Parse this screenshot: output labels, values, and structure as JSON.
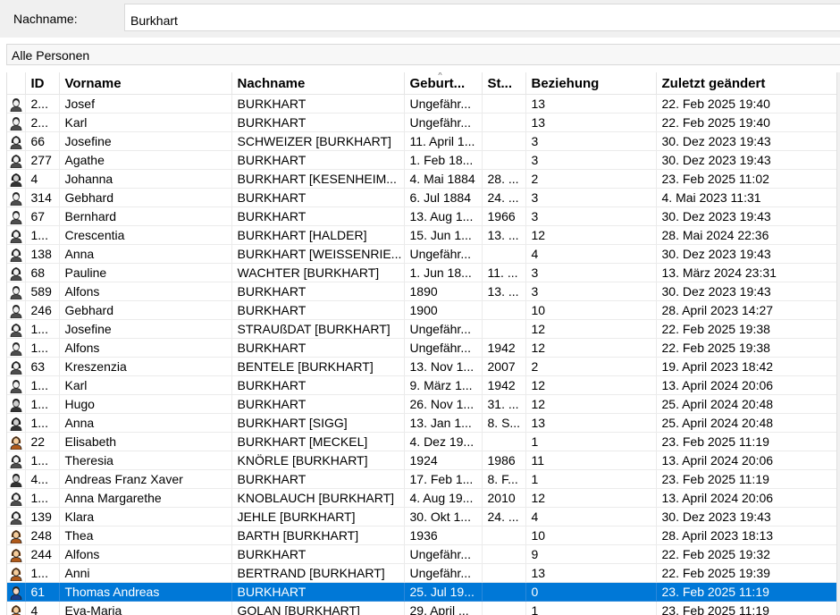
{
  "search": {
    "label": "Nachname:",
    "value": "Burkhart"
  },
  "filter": {
    "label": "Alle Personen"
  },
  "columns": [
    "ID",
    "Vorname",
    "Nachname",
    "Geburt...",
    "St...",
    "Beziehung",
    "Zuletzt geändert"
  ],
  "rows": [
    {
      "icon": "male",
      "id": "2...",
      "first": "Josef",
      "last": "BURKHART",
      "birth": "Ungefähr...",
      "death": "",
      "rel": "13",
      "changed": "22. Feb 2025 19:40"
    },
    {
      "icon": "male",
      "id": "2...",
      "first": "Karl",
      "last": "BURKHART",
      "birth": "Ungefähr...",
      "death": "",
      "rel": "13",
      "changed": "22. Feb 2025 19:40"
    },
    {
      "icon": "female",
      "id": "66",
      "first": "Josefine",
      "last": "SCHWEIZER [BURKHART]",
      "birth": "11. April 1...",
      "death": "",
      "rel": "3",
      "changed": "30. Dez 2023 19:43"
    },
    {
      "icon": "female",
      "id": "277",
      "first": "Agathe",
      "last": "BURKHART",
      "birth": "1. Feb 18...",
      "death": "",
      "rel": "3",
      "changed": "30. Dez 2023 19:43"
    },
    {
      "icon": "female-photo",
      "id": "4",
      "first": "Johanna",
      "last": "BURKHART [KESENHEIM...",
      "birth": "4. Mai 1884",
      "death": "28. ...",
      "rel": "2",
      "changed": "23. Feb 2025 11:02"
    },
    {
      "icon": "male",
      "id": "314",
      "first": "Gebhard",
      "last": "BURKHART",
      "birth": "6. Jul 1884",
      "death": "24. ...",
      "rel": "3",
      "changed": "4. Mai 2023 11:31"
    },
    {
      "icon": "male",
      "id": "67",
      "first": "Bernhard",
      "last": "BURKHART",
      "birth": "13. Aug 1...",
      "death": "1966",
      "rel": "3",
      "changed": "30. Dez 2023 19:43"
    },
    {
      "icon": "female",
      "id": "1...",
      "first": "Crescentia",
      "last": "BURKHART [HALDER]",
      "birth": "15. Jun 1...",
      "death": "13. ...",
      "rel": "12",
      "changed": "28. Mai 2024 22:36"
    },
    {
      "icon": "female",
      "id": "138",
      "first": "Anna",
      "last": "BURKHART [WEISSENRIE...",
      "birth": "Ungefähr...",
      "death": "",
      "rel": "4",
      "changed": "30. Dez 2023 19:43"
    },
    {
      "icon": "female",
      "id": "68",
      "first": "Pauline",
      "last": "WACHTER [BURKHART]",
      "birth": "1. Jun 18...",
      "death": "11. ...",
      "rel": "3",
      "changed": "13. März 2024 23:31"
    },
    {
      "icon": "male",
      "id": "589",
      "first": "Alfons",
      "last": "BURKHART",
      "birth": "1890",
      "death": "13. ...",
      "rel": "3",
      "changed": "30. Dez 2023 19:43"
    },
    {
      "icon": "male",
      "id": "246",
      "first": "Gebhard",
      "last": "BURKHART",
      "birth": "1900",
      "death": "",
      "rel": "10",
      "changed": "28. April 2023 14:27"
    },
    {
      "icon": "female",
      "id": "1...",
      "first": "Josefine",
      "last": "STRAUßDAT [BURKHART]",
      "birth": "Ungefähr...",
      "death": "",
      "rel": "12",
      "changed": "22. Feb 2025 19:38"
    },
    {
      "icon": "male",
      "id": "1...",
      "first": "Alfons",
      "last": "BURKHART",
      "birth": "Ungefähr...",
      "death": "1942",
      "rel": "12",
      "changed": "22. Feb 2025 19:38"
    },
    {
      "icon": "female",
      "id": "63",
      "first": "Kreszenzia",
      "last": "BENTELE [BURKHART]",
      "birth": "13. Nov 1...",
      "death": "2007",
      "rel": "2",
      "changed": "19. April 2023 18:42"
    },
    {
      "icon": "male",
      "id": "1...",
      "first": "Karl",
      "last": "BURKHART",
      "birth": "9. März 1...",
      "death": "1942",
      "rel": "12",
      "changed": "13. April 2024 20:06"
    },
    {
      "icon": "male-photo",
      "id": "1...",
      "first": "Hugo",
      "last": "BURKHART",
      "birth": "26. Nov 1...",
      "death": "31. ...",
      "rel": "12",
      "changed": "25. April 2024 20:48"
    },
    {
      "icon": "female-photo",
      "id": "1...",
      "first": "Anna",
      "last": "BURKHART [SIGG]",
      "birth": "13. Jan 1...",
      "death": "8. S...",
      "rel": "13",
      "changed": "25. April 2024 20:48"
    },
    {
      "icon": "female-color",
      "id": "22",
      "first": "Elisabeth",
      "last": "BURKHART [MECKEL]",
      "birth": "4. Dez 19...",
      "death": "",
      "rel": "1",
      "changed": "23. Feb 2025 11:19"
    },
    {
      "icon": "female",
      "id": "1...",
      "first": "Theresia",
      "last": "KNÖRLE [BURKHART]",
      "birth": "1924",
      "death": "1986",
      "rel": "11",
      "changed": "13. April 2024 20:06"
    },
    {
      "icon": "male-photo",
      "id": "4...",
      "first": "Andreas Franz Xaver",
      "last": "BURKHART",
      "birth": "17. Feb 1...",
      "death": "8. F...",
      "rel": "1",
      "changed": "23. Feb 2025 11:19"
    },
    {
      "icon": "female",
      "id": "1...",
      "first": "Anna Margarethe",
      "last": "KNOBLAUCH [BURKHART]",
      "birth": "4. Aug 19...",
      "death": "2010",
      "rel": "12",
      "changed": "13. April 2024 20:06"
    },
    {
      "icon": "female",
      "id": "139",
      "first": "Klara",
      "last": "JEHLE [BURKHART]",
      "birth": "30. Okt 1...",
      "death": "24. ...",
      "rel": "4",
      "changed": "30. Dez 2023 19:43"
    },
    {
      "icon": "female-color",
      "id": "248",
      "first": "Thea",
      "last": "BARTH [BURKHART]",
      "birth": "1936",
      "death": "",
      "rel": "10",
      "changed": "28. April 2023 18:13"
    },
    {
      "icon": "female-color",
      "id": "244",
      "first": "Alfons",
      "last": "BURKHART",
      "birth": "Ungefähr...",
      "death": "",
      "rel": "9",
      "changed": "22. Feb 2025 19:32"
    },
    {
      "icon": "female-color",
      "id": "1...",
      "first": "Anni",
      "last": "BERTRAND [BURKHART]",
      "birth": "Ungefähr...",
      "death": "",
      "rel": "13",
      "changed": "22. Feb 2025 19:39"
    },
    {
      "icon": "male-color",
      "id": "61",
      "first": "Thomas Andreas",
      "last": "BURKHART",
      "birth": "25. Jul 19...",
      "death": "",
      "rel": "0",
      "changed": "23. Feb 2025 11:19",
      "selected": true
    },
    {
      "icon": "female-color",
      "id": "4",
      "first": "Eva-Maria",
      "last": "GOLAN [BURKHART]",
      "birth": "29. April ...",
      "death": "",
      "rel": "1",
      "changed": "23. Feb 2025 11:19"
    }
  ]
}
